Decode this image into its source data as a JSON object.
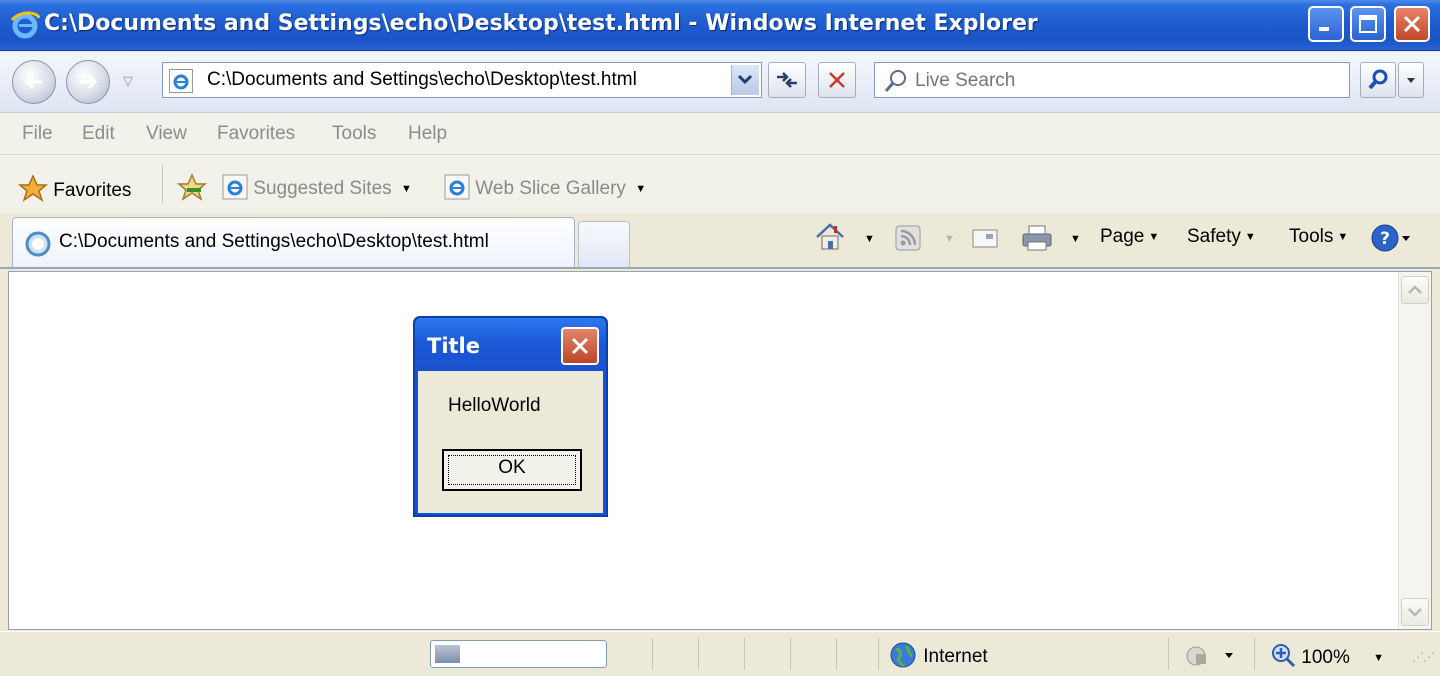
{
  "window": {
    "title": "C:\\Documents and Settings\\echo\\Desktop\\test.html - Windows Internet Explorer",
    "icons": [
      "ie-logo-icon",
      "minimize-icon",
      "maximize-icon",
      "close-icon"
    ]
  },
  "address_bar": {
    "url": "C:\\Documents and Settings\\echo\\Desktop\\test.html",
    "search_placeholder": "Live Search"
  },
  "menu": {
    "items": [
      "File",
      "Edit",
      "View",
      "Favorites",
      "Tools",
      "Help"
    ]
  },
  "favorites_bar": {
    "favorites_label": "Favorites",
    "suggested_sites": "Suggested Sites",
    "web_slice_gallery": "Web Slice Gallery"
  },
  "tab": {
    "title": "C:\\Documents and Settings\\echo\\Desktop\\test.html"
  },
  "command_bar": {
    "page": "Page",
    "safety": "Safety",
    "tools": "Tools"
  },
  "dialog": {
    "title": "Title",
    "message": "HelloWorld",
    "ok_label": "OK"
  },
  "status_bar": {
    "zone": "Internet",
    "zoom": "100%",
    "progress_fraction": 0.15
  },
  "colors": {
    "titlebar": "#1f5ccf",
    "window_face": "#ece9d8",
    "close_red": "#c2492a"
  }
}
